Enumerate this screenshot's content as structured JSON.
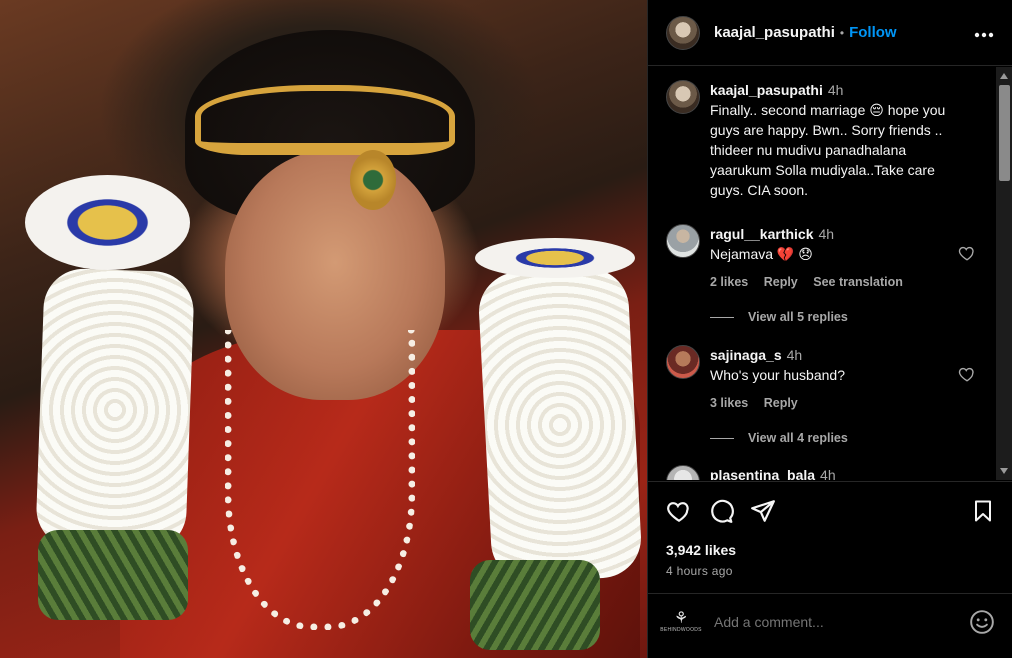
{
  "post": {
    "username": "kaajal_pasupathi",
    "separator": "•",
    "follow_label": "Follow",
    "more_icon": "more-horizontal-icon"
  },
  "caption": {
    "username": "kaajal_pasupathi",
    "time": "4h",
    "text": "Finally.. second marriage 😔 hope you guys are happy. Bwn.. Sorry friends .. thideer nu mudivu panadhalana yaarukum Solla mudiyala..Take care guys. CIA soon."
  },
  "comments": [
    {
      "username": "ragul__karthick",
      "time": "4h",
      "text": "Nejamava 💔 😞",
      "likes": "2 likes",
      "reply_label": "Reply",
      "translate_label": "See translation",
      "view_replies": "View all 5 replies"
    },
    {
      "username": "sajinaga_s",
      "time": "4h",
      "text": "Who's your husband?",
      "likes": "3 likes",
      "reply_label": "Reply",
      "view_replies": "View all 4 replies"
    },
    {
      "username": "plasentina_bala",
      "time": "4h"
    }
  ],
  "stats": {
    "likes": "3,942 likes",
    "time_ago": "4 hours ago"
  },
  "add_comment": {
    "placeholder": "Add a comment...",
    "brand_mark": "⚘",
    "brand_text": "BEHINDWOODS"
  }
}
